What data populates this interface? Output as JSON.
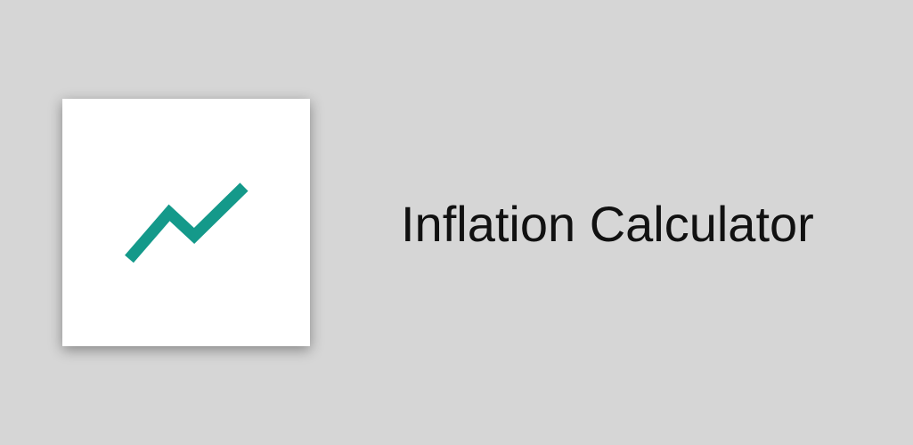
{
  "app": {
    "title": "Inflation Calculator",
    "icon": "trending-up-icon"
  },
  "colors": {
    "background": "#d6d6d6",
    "icon_card": "#ffffff",
    "accent": "#14998a",
    "title_text": "#111111"
  }
}
